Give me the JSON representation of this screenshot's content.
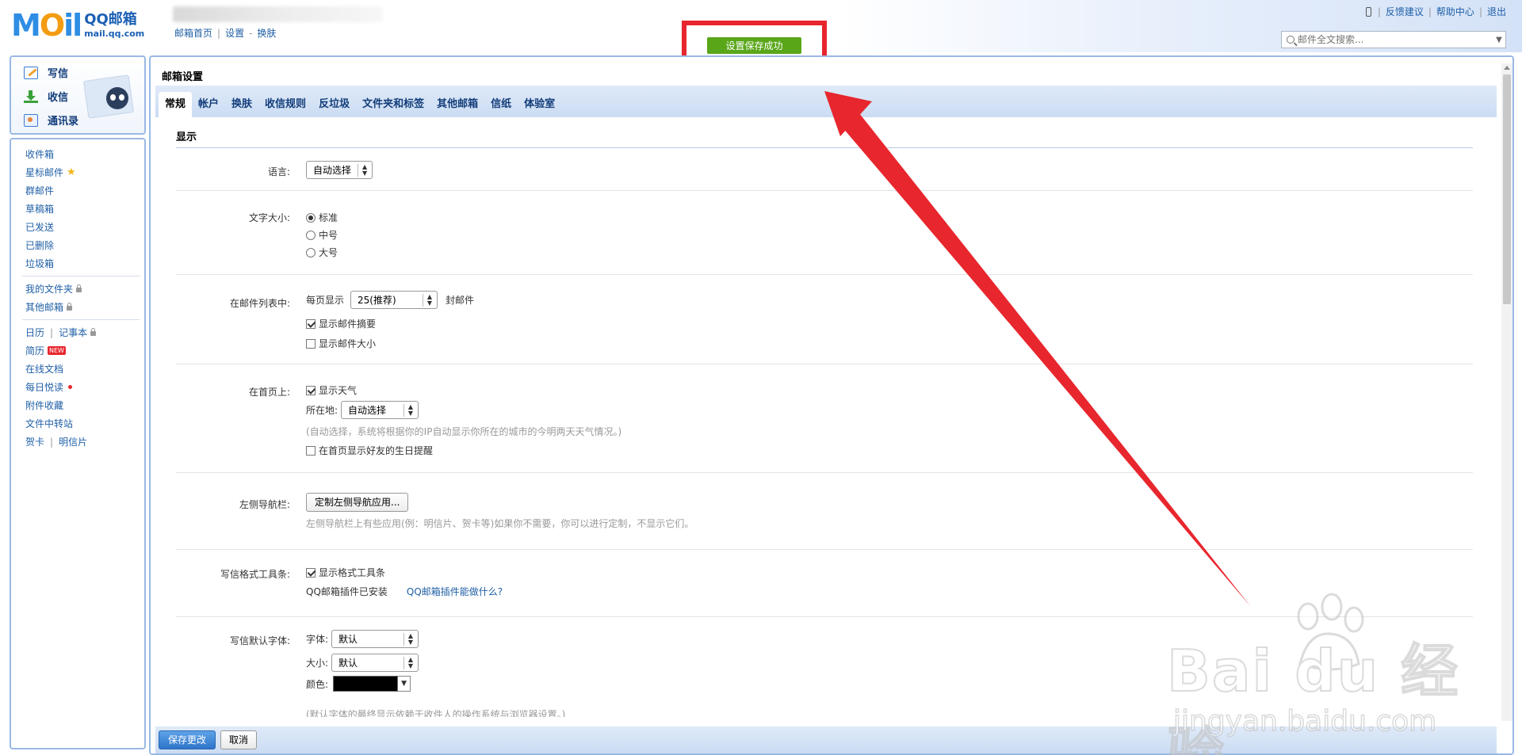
{
  "header": {
    "logo_mail": "MAIL",
    "logo_qq": "QQ邮箱",
    "logo_domain": "mail.qq.com",
    "top_links": [
      "邮箱首页",
      "设置",
      "换肤"
    ],
    "right_links": [
      "反馈建议",
      "帮助中心",
      "退出"
    ],
    "search_placeholder": "邮件全文搜索...",
    "toast": "设置保存成功"
  },
  "sidebar": {
    "actions": [
      "写信",
      "收信",
      "通讯录"
    ],
    "folders": [
      "收件箱",
      "星标邮件",
      "群邮件",
      "草稿箱",
      "已发送",
      "已删除",
      "垃圾箱"
    ],
    "my_folders": "我的文件夹",
    "other_mail": "其他邮箱",
    "calendar": "日历",
    "notes": "记事本",
    "resume": "简历",
    "new_badge": "NEW",
    "online_docs": "在线文档",
    "daily_read": "每日悦读",
    "attachments": "附件收藏",
    "file_transfer": "文件中转站",
    "greeting_card": "贺卡",
    "postcard": "明信片"
  },
  "main": {
    "title": "邮箱设置",
    "tabs": [
      "常规",
      "帐户",
      "换肤",
      "收信规则",
      "反垃圾",
      "文件夹和标签",
      "其他邮箱",
      "信纸",
      "体验室"
    ],
    "active_tab": "常规",
    "section_title": "显示",
    "language": {
      "label": "语言:",
      "value": "自动选择"
    },
    "font_size": {
      "label": "文字大小:",
      "options": [
        "标准",
        "中号",
        "大号"
      ],
      "selected": "标准"
    },
    "mail_list": {
      "label": "在邮件列表中:",
      "per_page_prefix": "每页显示",
      "per_page_value": "25(推荐)",
      "per_page_suffix": "封邮件",
      "show_summary": "显示邮件摘要",
      "show_size": "显示邮件大小"
    },
    "homepage": {
      "label": "在首页上:",
      "show_weather": "显示天气",
      "location_label": "所在地:",
      "location_value": "自动选择",
      "hint": "(自动选择，系统将根据你的IP自动显示你所在的城市的今明两天天气情况。)",
      "birthday": "在首页显示好友的生日提醒"
    },
    "left_nav": {
      "label": "左侧导航栏:",
      "button": "定制左侧导航应用...",
      "hint": "左侧导航栏上有些应用(例：明信片、贺卡等)如果你不需要，你可以进行定制，不显示它们。"
    },
    "format_toolbar": {
      "label": "写信格式工具条:",
      "show_toolbar": "显示格式工具条",
      "plugin_installed": "QQ邮箱插件已安装",
      "plugin_link": "QQ邮箱插件能做什么?"
    },
    "default_font": {
      "label": "写信默认字体:",
      "font_label": "字体:",
      "font_value": "默认",
      "size_label": "大小:",
      "size_value": "默认",
      "color_label": "颜色:",
      "color_value": "#000000",
      "hint": "(默认字体的最终显示依赖于收件人的操作系统与浏览器设置。)"
    },
    "save_button": "保存更改",
    "cancel_button": "取消"
  },
  "annotation": {
    "arrow_color": "#e8262d"
  },
  "watermark": {
    "brand": "Bai du 经验",
    "url": "jingyan.baidu.com"
  }
}
